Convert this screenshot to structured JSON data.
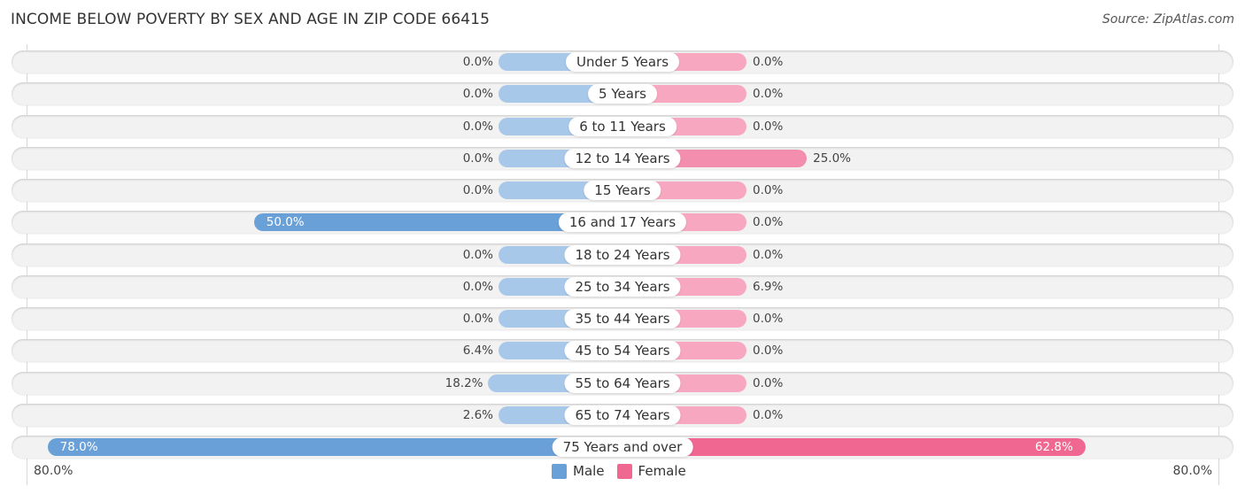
{
  "header": {
    "title": "INCOME BELOW POVERTY BY SEX AND AGE IN ZIP CODE 66415",
    "source": "Source: ZipAtlas.com"
  },
  "chart_data": {
    "type": "bar",
    "orientation": "horizontal-diverging",
    "title": "INCOME BELOW POVERTY BY SEX AND AGE IN ZIP CODE 66415",
    "categories": [
      "Under 5 Years",
      "5 Years",
      "6 to 11 Years",
      "12 to 14 Years",
      "15 Years",
      "16 and 17 Years",
      "18 to 24 Years",
      "25 to 34 Years",
      "35 to 44 Years",
      "45 to 54 Years",
      "55 to 64 Years",
      "65 to 74 Years",
      "75 Years and over"
    ],
    "series": [
      {
        "name": "Male",
        "color": "#6aa0d8",
        "light_color": "#a8c8ea",
        "values": [
          0.0,
          0.0,
          0.0,
          0.0,
          0.0,
          50.0,
          0.0,
          0.0,
          0.0,
          6.4,
          18.2,
          2.6,
          78.0
        ],
        "labels": [
          "0.0%",
          "0.0%",
          "0.0%",
          "0.0%",
          "0.0%",
          "50.0%",
          "0.0%",
          "0.0%",
          "0.0%",
          "6.4%",
          "18.2%",
          "2.6%",
          "78.0%"
        ]
      },
      {
        "name": "Female",
        "color": "#f06892",
        "light_color": "#f7a8c0",
        "values": [
          0.0,
          0.0,
          0.0,
          25.0,
          0.0,
          0.0,
          0.0,
          6.9,
          0.0,
          0.0,
          0.0,
          0.0,
          62.8
        ],
        "labels": [
          "0.0%",
          "0.0%",
          "0.0%",
          "25.0%",
          "0.0%",
          "0.0%",
          "0.0%",
          "6.9%",
          "0.0%",
          "0.0%",
          "0.0%",
          "0.0%",
          "62.8%"
        ]
      }
    ],
    "xlim": [
      -80,
      80
    ],
    "axis_labels": {
      "left": "80.0%",
      "right": "80.0%"
    },
    "legend": {
      "position": "bottom-center",
      "entries": [
        "Male",
        "Female"
      ]
    },
    "grid": false
  }
}
